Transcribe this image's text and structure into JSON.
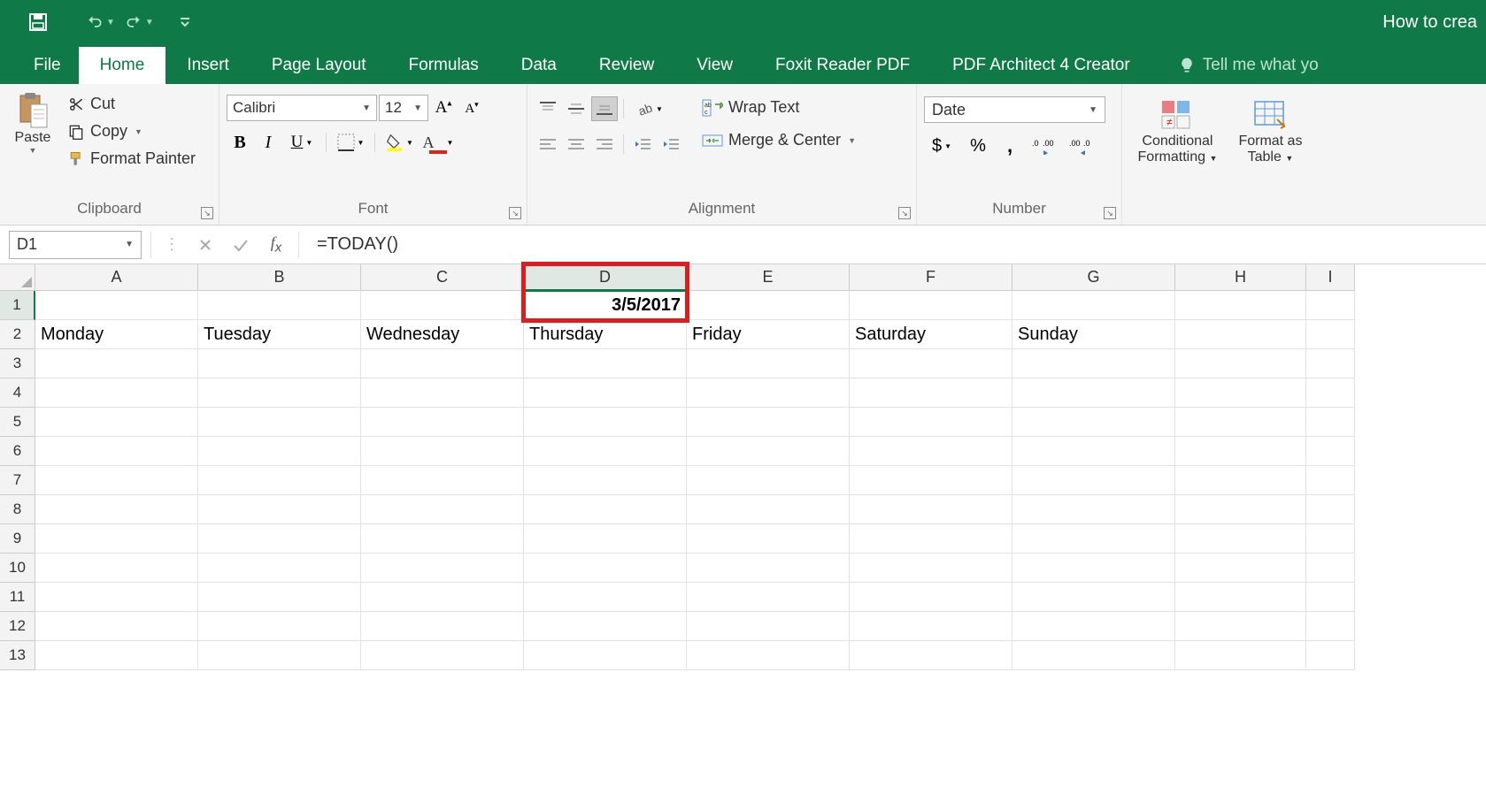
{
  "titlebar": {
    "title_fragment": "How to crea"
  },
  "tabs": {
    "file": "File",
    "home": "Home",
    "insert": "Insert",
    "page_layout": "Page Layout",
    "formulas": "Formulas",
    "data": "Data",
    "review": "Review",
    "view": "View",
    "foxit": "Foxit Reader PDF",
    "pdfarch": "PDF Architect 4 Creator",
    "tellme": "Tell me what yo"
  },
  "ribbon": {
    "clipboard": {
      "label": "Clipboard",
      "paste": "Paste",
      "cut": "Cut",
      "copy": "Copy",
      "format_painter": "Format Painter"
    },
    "font": {
      "label": "Font",
      "name": "Calibri",
      "size": "12"
    },
    "alignment": {
      "label": "Alignment",
      "wrap": "Wrap Text",
      "merge": "Merge & Center"
    },
    "number": {
      "label": "Number",
      "format": "Date"
    },
    "styles": {
      "conditional": "Conditional",
      "formatting": "Formatting",
      "format_as": "Format as",
      "table": "Table"
    }
  },
  "formula_bar": {
    "cell_ref": "D1",
    "formula": "=TODAY()"
  },
  "grid": {
    "columns": [
      "A",
      "B",
      "C",
      "D",
      "E",
      "F",
      "G",
      "H",
      "I"
    ],
    "rows": [
      1,
      2,
      3,
      4,
      5,
      6,
      7,
      8,
      9,
      10,
      11,
      12,
      13
    ],
    "selected_column": "D",
    "selected_row": 1,
    "cells": {
      "D1": "3/5/2017",
      "A2": "Monday",
      "B2": "Tuesday",
      "C2": "Wednesday",
      "D2": "Thursday",
      "E2": "Friday",
      "F2": "Saturday",
      "G2": "Sunday"
    },
    "callout": {
      "around": "D-header-and-D1"
    }
  }
}
